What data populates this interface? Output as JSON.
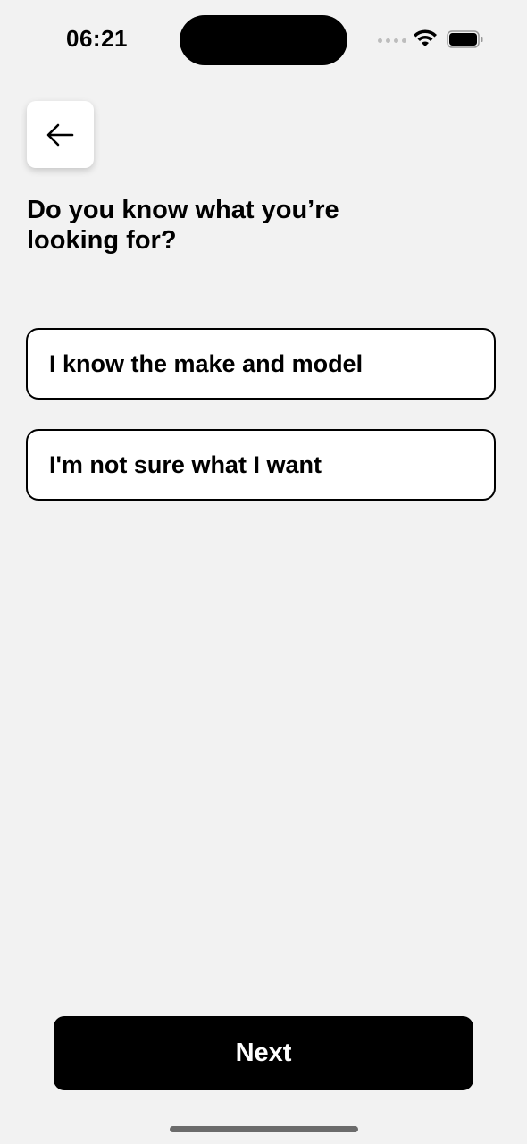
{
  "status_bar": {
    "time": "06:21"
  },
  "header": {
    "back_icon": "arrow-left-icon",
    "title": "Do you know what you’re looking for?"
  },
  "options": [
    {
      "label": "I know the make and model"
    },
    {
      "label": "I'm not sure what I want"
    }
  ],
  "footer": {
    "next_label": "Next"
  },
  "colors": {
    "background": "#f2f2f2",
    "card": "#ffffff",
    "primary": "#000000"
  }
}
